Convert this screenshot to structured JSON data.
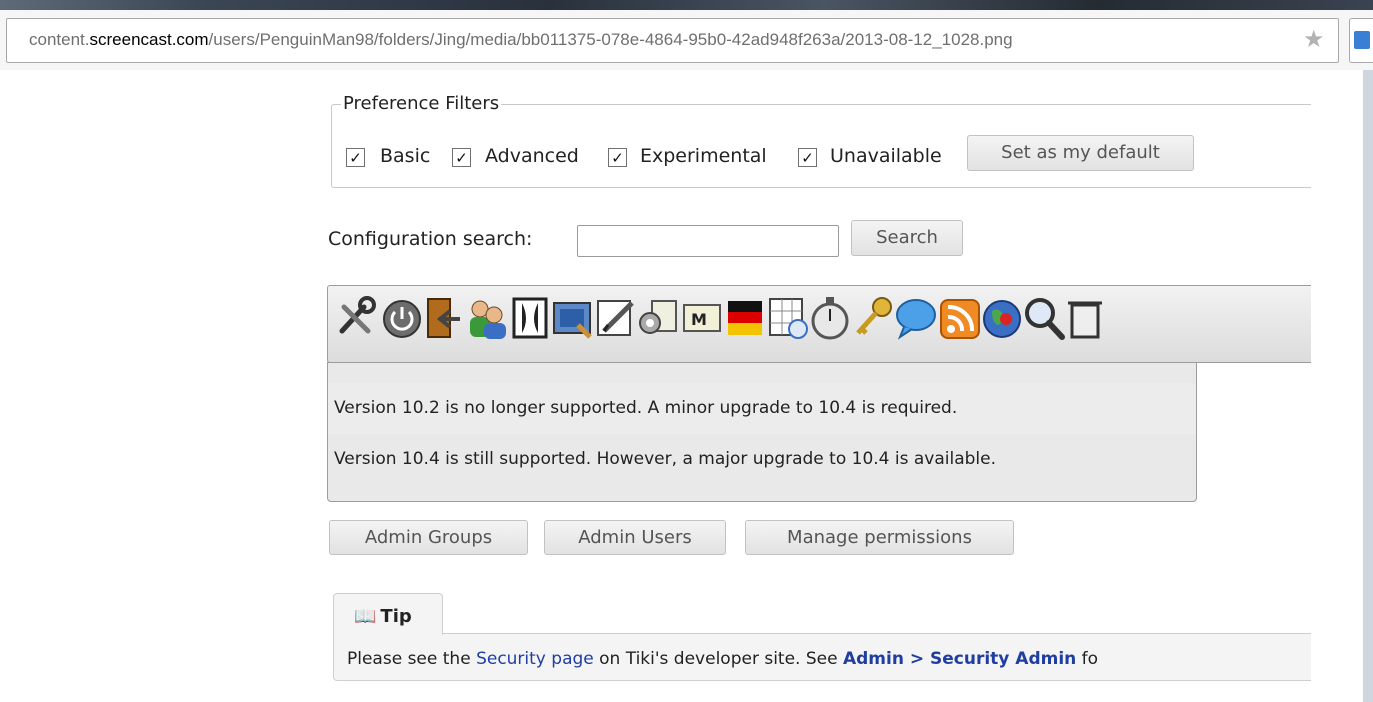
{
  "browser": {
    "url_prefix": "content.",
    "url_domain": "screencast.com",
    "url_path": "/users/PenguinMan98/folders/Jing/media/bb011375-078e-4864-95b0-42ad948f263a/2013-08-12_1028.png",
    "star_icon": "star-icon"
  },
  "preference_filters": {
    "legend": "Preference Filters",
    "checkboxes": [
      {
        "label": "Basic",
        "checked": true
      },
      {
        "label": "Advanced",
        "checked": true
      },
      {
        "label": "Experimental",
        "checked": true
      },
      {
        "label": "Unavailable",
        "checked": true
      }
    ],
    "default_button": "Set as my default"
  },
  "search": {
    "label": "Configuration search:",
    "value": "",
    "button": "Search"
  },
  "icons": [
    "tools-icon",
    "power-icon",
    "exit-door-icon",
    "users-icon",
    "layout-icon",
    "picture-icon",
    "edit-pencil-icon",
    "features-icon",
    "mail-icon",
    "flag-icon",
    "calendar-compass-icon",
    "stopwatch-icon",
    "keys-icon",
    "chat-bubble-icon",
    "rss-icon",
    "globe-icon",
    "search-magnifier-icon",
    "trash-icon"
  ],
  "messages": [
    "Version 10.2 is no longer supported. A minor upgrade to 10.4 is required.",
    "Version 10.4 is still supported. However, a major upgrade to 10.4 is available."
  ],
  "admin_buttons": [
    "Admin Groups",
    "Admin Users",
    "Manage permissions"
  ],
  "tip": {
    "title": "Tip",
    "text_before": "Please see the ",
    "link1": "Security page",
    "text_middle": " on Tiki's developer site. See ",
    "link2": "Admin > Security Admin",
    "text_after": " fo"
  }
}
